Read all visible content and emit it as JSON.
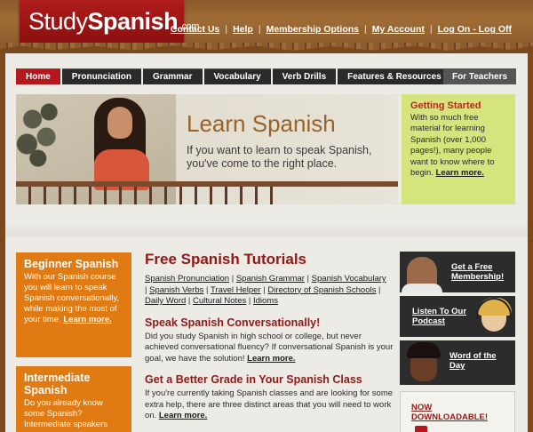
{
  "header": {
    "logo": {
      "part1": "Study",
      "part2": "Spanish",
      "suffix": ".com"
    },
    "top_nav": [
      "Contact Us",
      "Help",
      "Membership Options",
      "My Account",
      "Log On - Log Off"
    ]
  },
  "tabs": {
    "items": [
      "Home",
      "Pronunciation",
      "Grammar",
      "Vocabulary",
      "Verb Drills",
      "Features & Resources"
    ],
    "teacher": "For Teachers",
    "active_index": 0
  },
  "hero": {
    "title": "Learn Spanish",
    "text": "If you want to learn to speak Spanish, you've come to the right place."
  },
  "getting_started": {
    "title": "Getting Started",
    "text": "With so much free material for learning Spanish (over 1,000 pages!), many people want to know where to begin.",
    "link": "Learn more."
  },
  "left_boxes": [
    {
      "title": "Beginner Spanish",
      "text": "With our Spanish course you will learn to speak Spanish conversationally, while making the most of your time.",
      "link": "Learn more."
    },
    {
      "title": "Intermediate Spanish",
      "text": "Do you already know some Spanish? Intermediate speakers"
    }
  ],
  "center": {
    "title": "Free Spanish Tutorials",
    "links": [
      "Spanish Pronunciation",
      "Spanish Grammar",
      "Spanish Vocabulary",
      "Spanish Verbs",
      "Travel Helper",
      "Directory of Spanish Schools",
      "Daily Word",
      "Cultural Notes",
      "Idioms"
    ],
    "section1": {
      "title": "Speak Spanish Conversationally!",
      "text": "Did you study Spanish in high school or college, but never achieved conversational fluency? If conversational Spanish is your goal, we have the solution!",
      "link": "Learn more."
    },
    "section2": {
      "title": "Get a Better Grade in Your Spanish Class",
      "text": "If you're currently taking Spanish classes and are looking for some extra help, there are three distinct areas that you will need to work on.",
      "link": "Learn more."
    }
  },
  "right_promos": [
    {
      "text": "Get a Free Membership!"
    },
    {
      "text": "Listen To Our Podcast"
    },
    {
      "text": "Word of the Day"
    },
    {
      "text": "NOW DOWNLOADABLE!"
    }
  ],
  "colors": {
    "brand_red": "#b5171d",
    "accent_orange": "#e07a12",
    "accent_green": "#d6e47e",
    "heading_red": "#8e1a17",
    "hero_title": "#9a6228"
  }
}
